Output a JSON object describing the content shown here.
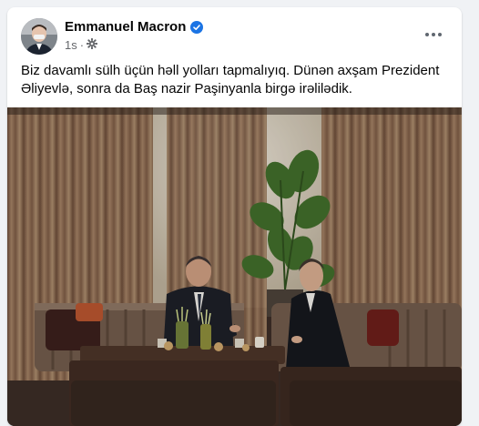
{
  "post": {
    "author": "Emmanuel Macron",
    "time": "1s",
    "privacy_icon": "gear-icon",
    "verified_icon": "verified-badge-icon",
    "more_icon": "more-options-icon",
    "text": "Biz davamlı sülh üçün həll yolları tapmalıyıq. Dünən axşam Prezident Əliyevlə, sonra da Baş nazir Paşinyanla birgə irəlilədik."
  },
  "colors": {
    "brand_blue": "#1b74e4",
    "text_primary": "#050505",
    "text_secondary": "#65676b",
    "page_bg": "#f0f2f5"
  }
}
